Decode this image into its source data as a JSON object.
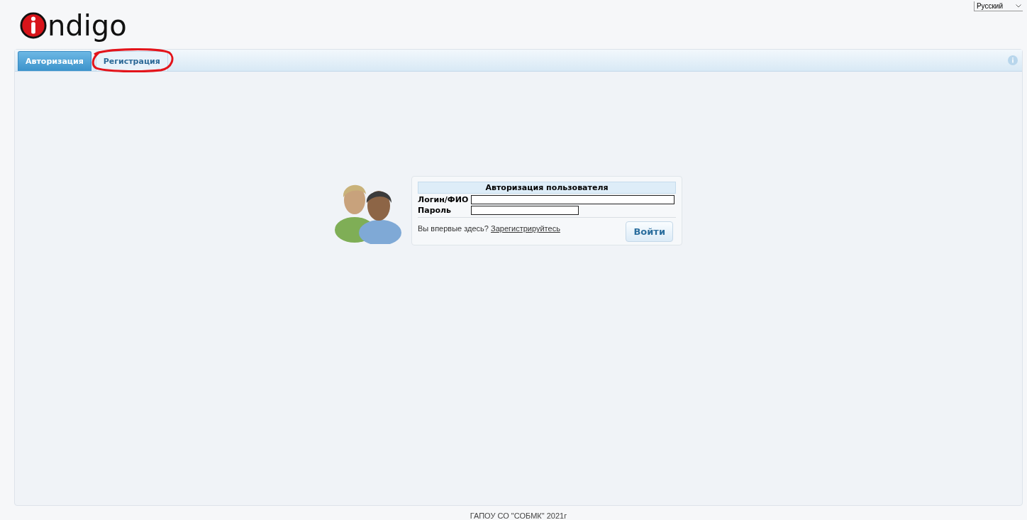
{
  "logo": {
    "text": "ndigo"
  },
  "language": {
    "value": "Русский"
  },
  "tabs": [
    {
      "label": "Авторизация",
      "selected": true,
      "circled": false
    },
    {
      "label": "Регистрация",
      "selected": false,
      "circled": true
    }
  ],
  "login": {
    "title": "Авторизация пользователя",
    "login_label": "Логин/ФИО",
    "password_label": "Пароль",
    "prompt": "Вы впервые здесь?",
    "register_link": "Зарегистрируйтесь",
    "submit": "Войти"
  },
  "footer": "ГАПОУ СО \"СОБМК\" 2021г"
}
